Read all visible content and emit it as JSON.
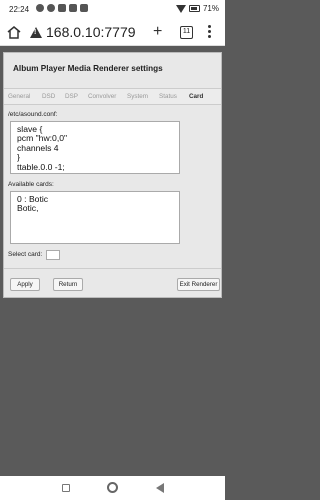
{
  "status_bar": {
    "time": "22:24",
    "battery": "71%"
  },
  "browser": {
    "url": "168.0.10:7779",
    "tab_count": "11"
  },
  "page": {
    "title": "Album Player Media Renderer settings",
    "tabs": [
      {
        "label": "General"
      },
      {
        "label": "DSD"
      },
      {
        "label": "DSP"
      },
      {
        "label": "Convolver"
      },
      {
        "label": "System"
      },
      {
        "label": "Status"
      },
      {
        "label": "Card"
      }
    ],
    "config_label": "/etc/asound.conf:",
    "config_text": "slave {\npcm \"hw:0,0\"\nchannels 4\n}\nttable.0.0 -1;",
    "cards_label": "Available cards:",
    "cards_text": "0 : Botic\nBotic,",
    "select_card_label": "Select card:",
    "select_card_value": "",
    "buttons": {
      "apply": "Apply",
      "return": "Return",
      "exit": "Exit Renderer"
    }
  }
}
